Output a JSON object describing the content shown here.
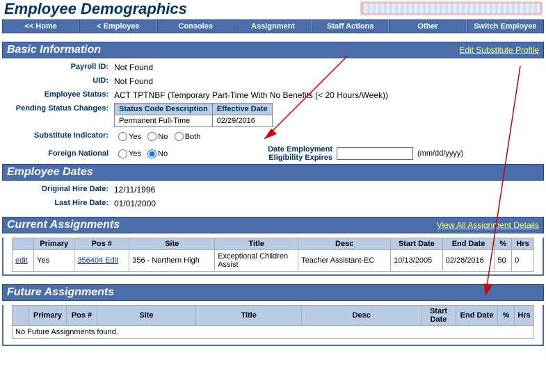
{
  "page_title": "Employee Demographics",
  "nav": {
    "home": "<< Home",
    "employee": "< Employee",
    "consoles": "Consoles",
    "assignment": "Assignment",
    "staff_actions": "Staff Actions",
    "other": "Other",
    "switch": "Switch Employee"
  },
  "sections": {
    "basic": {
      "title": "Basic Information",
      "link": "Edit Substitute Profile",
      "payroll_label": "Payroll ID:",
      "payroll_value": "Not Found",
      "uid_label": "UID:",
      "uid_value": "Not Found",
      "status_label": "Employee Status:",
      "status_value": "ACT TPTNBF (Temporary Part-Time With No Benefits (< 20 Hours/Week))",
      "pending_label": "Pending Status Changes:",
      "pending_th1": "Status Code Description",
      "pending_th2": "Effective Date",
      "pending_td1": "Permanent Full-Time",
      "pending_td2": "02/29/2016",
      "sub_ind_label": "Substitute Indicator:",
      "opt_yes": "Yes",
      "opt_no": "No",
      "opt_both": "Both",
      "foreign_label": "Foreign National",
      "elig_label_l1": "Date Employment",
      "elig_label_l2": "Eligibility Expires",
      "elig_hint": "(mm/dd/yyyy)",
      "elig_value": ""
    },
    "dates": {
      "title": "Employee Dates",
      "orig_label": "Original Hire Date:",
      "orig_value": "12/11/1996",
      "last_label": "Last Hire Date:",
      "last_value": "01/01/2000"
    },
    "current": {
      "title": "Current Assignments",
      "link": "View All Assignment Details",
      "headers": [
        "",
        "Primary",
        "Pos #",
        "Site",
        "Title",
        "Desc",
        "Start Date",
        "End Date",
        "%",
        "Hrs"
      ],
      "row": {
        "edit": "edit",
        "primary": "Yes",
        "pos_link": "356404 Edit",
        "site": "356 - Northern High",
        "title": "Exceptional Children Assist",
        "desc": "Teacher Assistant-EC",
        "start": "10/13/2005",
        "end": "02/28/2016",
        "pct": "50",
        "hrs": "0"
      }
    },
    "future": {
      "title": "Future Assignments",
      "headers": [
        "",
        "Primary",
        "Pos #",
        "Site",
        "Title",
        "Desc",
        "Start Date",
        "End Date",
        "%",
        "Hrs"
      ],
      "empty": "No Future Assignments found."
    }
  }
}
